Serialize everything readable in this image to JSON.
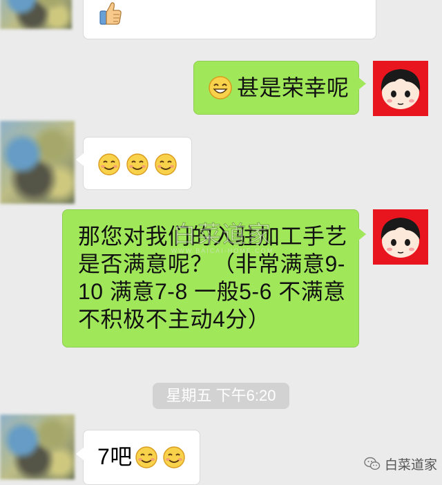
{
  "messages": [
    {
      "id": "m1",
      "side": "incoming",
      "emoji": [
        "thumbs-up-icon"
      ]
    },
    {
      "id": "m2",
      "side": "outgoing",
      "text": "甚是荣幸呢",
      "emoji": [
        "grinning-squint-icon"
      ]
    },
    {
      "id": "m3",
      "side": "incoming",
      "emoji": [
        "smiling-face-icon",
        "smiling-face-icon",
        "smiling-face-icon"
      ]
    },
    {
      "id": "m4",
      "side": "outgoing",
      "text": "那您对我们的入驻的加工手艺是否满意呢？（非常满意9-10 满意7-8 一般5-6 不满意不积极不主动4分）"
    },
    {
      "id": "m5",
      "side": "incoming",
      "text": "7吧",
      "emoji": [
        "smiling-face-icon",
        "smiling-face-icon"
      ]
    }
  ],
  "texts": {
    "m2_text": "甚是荣幸呢",
    "m4_line1": "那您对我们的入驻加工手艺",
    "m4_line2": "是否满意呢？（非常满意9-",
    "m4_line3": "10 满意7-8 一般5-6 不满意",
    "m4_line4": "不积极不主动4分）",
    "m5_text": "7吧"
  },
  "timestamp": "星期五 下午6:20",
  "watermark": {
    "center_text": "白菜道家",
    "center_sub": "WWW.BAICAI-HOME.COM",
    "corner_text": "白菜道家"
  },
  "colors": {
    "background": "#ebebeb",
    "outgoing_bubble": "#a0e75a",
    "incoming_bubble": "#ffffff",
    "avatar_red": "#e8141e"
  }
}
